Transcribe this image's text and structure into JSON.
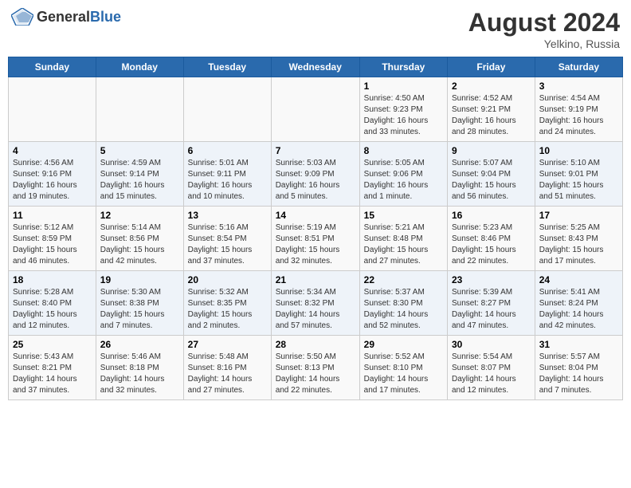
{
  "header": {
    "logo_general": "General",
    "logo_blue": "Blue",
    "main_title": "August 2024",
    "subtitle": "Yelkino, Russia"
  },
  "days_of_week": [
    "Sunday",
    "Monday",
    "Tuesday",
    "Wednesday",
    "Thursday",
    "Friday",
    "Saturday"
  ],
  "weeks": [
    [
      {
        "day": "",
        "info": ""
      },
      {
        "day": "",
        "info": ""
      },
      {
        "day": "",
        "info": ""
      },
      {
        "day": "",
        "info": ""
      },
      {
        "day": "1",
        "info": "Sunrise: 4:50 AM\nSunset: 9:23 PM\nDaylight: 16 hours\nand 33 minutes."
      },
      {
        "day": "2",
        "info": "Sunrise: 4:52 AM\nSunset: 9:21 PM\nDaylight: 16 hours\nand 28 minutes."
      },
      {
        "day": "3",
        "info": "Sunrise: 4:54 AM\nSunset: 9:19 PM\nDaylight: 16 hours\nand 24 minutes."
      }
    ],
    [
      {
        "day": "4",
        "info": "Sunrise: 4:56 AM\nSunset: 9:16 PM\nDaylight: 16 hours\nand 19 minutes."
      },
      {
        "day": "5",
        "info": "Sunrise: 4:59 AM\nSunset: 9:14 PM\nDaylight: 16 hours\nand 15 minutes."
      },
      {
        "day": "6",
        "info": "Sunrise: 5:01 AM\nSunset: 9:11 PM\nDaylight: 16 hours\nand 10 minutes."
      },
      {
        "day": "7",
        "info": "Sunrise: 5:03 AM\nSunset: 9:09 PM\nDaylight: 16 hours\nand 5 minutes."
      },
      {
        "day": "8",
        "info": "Sunrise: 5:05 AM\nSunset: 9:06 PM\nDaylight: 16 hours\nand 1 minute."
      },
      {
        "day": "9",
        "info": "Sunrise: 5:07 AM\nSunset: 9:04 PM\nDaylight: 15 hours\nand 56 minutes."
      },
      {
        "day": "10",
        "info": "Sunrise: 5:10 AM\nSunset: 9:01 PM\nDaylight: 15 hours\nand 51 minutes."
      }
    ],
    [
      {
        "day": "11",
        "info": "Sunrise: 5:12 AM\nSunset: 8:59 PM\nDaylight: 15 hours\nand 46 minutes."
      },
      {
        "day": "12",
        "info": "Sunrise: 5:14 AM\nSunset: 8:56 PM\nDaylight: 15 hours\nand 42 minutes."
      },
      {
        "day": "13",
        "info": "Sunrise: 5:16 AM\nSunset: 8:54 PM\nDaylight: 15 hours\nand 37 minutes."
      },
      {
        "day": "14",
        "info": "Sunrise: 5:19 AM\nSunset: 8:51 PM\nDaylight: 15 hours\nand 32 minutes."
      },
      {
        "day": "15",
        "info": "Sunrise: 5:21 AM\nSunset: 8:48 PM\nDaylight: 15 hours\nand 27 minutes."
      },
      {
        "day": "16",
        "info": "Sunrise: 5:23 AM\nSunset: 8:46 PM\nDaylight: 15 hours\nand 22 minutes."
      },
      {
        "day": "17",
        "info": "Sunrise: 5:25 AM\nSunset: 8:43 PM\nDaylight: 15 hours\nand 17 minutes."
      }
    ],
    [
      {
        "day": "18",
        "info": "Sunrise: 5:28 AM\nSunset: 8:40 PM\nDaylight: 15 hours\nand 12 minutes."
      },
      {
        "day": "19",
        "info": "Sunrise: 5:30 AM\nSunset: 8:38 PM\nDaylight: 15 hours\nand 7 minutes."
      },
      {
        "day": "20",
        "info": "Sunrise: 5:32 AM\nSunset: 8:35 PM\nDaylight: 15 hours\nand 2 minutes."
      },
      {
        "day": "21",
        "info": "Sunrise: 5:34 AM\nSunset: 8:32 PM\nDaylight: 14 hours\nand 57 minutes."
      },
      {
        "day": "22",
        "info": "Sunrise: 5:37 AM\nSunset: 8:30 PM\nDaylight: 14 hours\nand 52 minutes."
      },
      {
        "day": "23",
        "info": "Sunrise: 5:39 AM\nSunset: 8:27 PM\nDaylight: 14 hours\nand 47 minutes."
      },
      {
        "day": "24",
        "info": "Sunrise: 5:41 AM\nSunset: 8:24 PM\nDaylight: 14 hours\nand 42 minutes."
      }
    ],
    [
      {
        "day": "25",
        "info": "Sunrise: 5:43 AM\nSunset: 8:21 PM\nDaylight: 14 hours\nand 37 minutes."
      },
      {
        "day": "26",
        "info": "Sunrise: 5:46 AM\nSunset: 8:18 PM\nDaylight: 14 hours\nand 32 minutes."
      },
      {
        "day": "27",
        "info": "Sunrise: 5:48 AM\nSunset: 8:16 PM\nDaylight: 14 hours\nand 27 minutes."
      },
      {
        "day": "28",
        "info": "Sunrise: 5:50 AM\nSunset: 8:13 PM\nDaylight: 14 hours\nand 22 minutes."
      },
      {
        "day": "29",
        "info": "Sunrise: 5:52 AM\nSunset: 8:10 PM\nDaylight: 14 hours\nand 17 minutes."
      },
      {
        "day": "30",
        "info": "Sunrise: 5:54 AM\nSunset: 8:07 PM\nDaylight: 14 hours\nand 12 minutes."
      },
      {
        "day": "31",
        "info": "Sunrise: 5:57 AM\nSunset: 8:04 PM\nDaylight: 14 hours\nand 7 minutes."
      }
    ]
  ]
}
